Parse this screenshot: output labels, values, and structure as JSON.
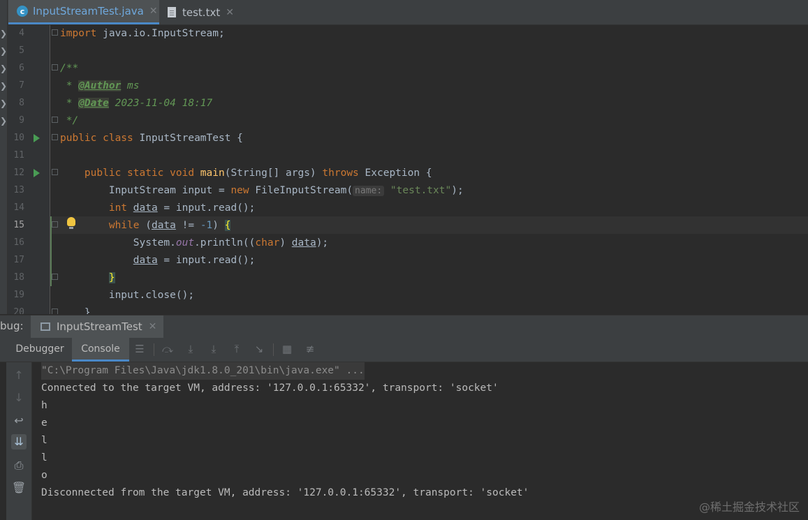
{
  "tabs": [
    {
      "label": "InputStreamTest.java",
      "icon": "java-class-icon",
      "active": true
    },
    {
      "label": "test.txt",
      "icon": "text-file-icon",
      "active": false
    }
  ],
  "tab_close": "✕",
  "editor": {
    "line_numbers": [
      "4",
      "5",
      "6",
      "7",
      "8",
      "9",
      "10",
      "11",
      "12",
      "13",
      "14",
      "15",
      "16",
      "17",
      "18",
      "19",
      "20"
    ],
    "current_line": "15",
    "code": {
      "l4_kw": "import",
      "l4_rest": " java.io.InputStream;",
      "l6": "/**",
      "l7_pre": " * ",
      "l7_tag": "@Author",
      "l7_val": " ms",
      "l8_pre": " * ",
      "l8_tag": "@Date",
      "l8_val": " 2023-11-04 18:17",
      "l9": " */",
      "l10_kw": "public class",
      "l10_rest": " InputStreamTest {",
      "l12_indent": "    ",
      "l12_kw": "public static void",
      "l12_sp": " ",
      "l12_fn": "main",
      "l12_args": "(String[] args) ",
      "l12_throws": "throws",
      "l12_rest": " Exception {",
      "l13_a": "        InputStream input = ",
      "l13_new": "new",
      "l13_b": " FileInputStream(",
      "l13_hint": "name:",
      "l13_sp": " ",
      "l13_str": "\"test.txt\"",
      "l13_c": ");",
      "l14_indent": "        ",
      "l14_kw": "int",
      "l14_sp": " ",
      "l14_var": "data",
      "l14_rest": " = input.read();",
      "l15_indent": "        ",
      "l15_kw": "while",
      "l15_a": " (",
      "l15_var": "data",
      "l15_b": " != ",
      "l15_num": "-1",
      "l15_c": ") ",
      "l15_brace": "{",
      "l16_a": "            System.",
      "l16_out": "out",
      "l16_b": ".println((",
      "l16_char": "char",
      "l16_c": ") ",
      "l16_var": "data",
      "l16_d": ");",
      "l17_indent": "            ",
      "l17_var": "data",
      "l17_rest": " = input.read();",
      "l18_indent": "        ",
      "l18_brace": "}",
      "l19": "        input.close();",
      "l20": "    }"
    }
  },
  "debug": {
    "title": "bug:",
    "session_tab": "InputStreamTest",
    "tabs": {
      "debugger": "Debugger",
      "console": "Console"
    },
    "toolbar_icons": [
      "menu-icon",
      "step-over-icon",
      "step-into-icon",
      "force-step-into-icon",
      "step-out-icon",
      "run-to-cursor-icon",
      "evaluate-icon",
      "trace-icon"
    ],
    "side_icons": [
      "up-arrow-icon",
      "down-arrow-icon",
      "soft-wrap-icon",
      "scroll-to-end-icon",
      "print-icon",
      "trash-icon"
    ]
  },
  "console": {
    "lines": [
      "\"C:\\Program Files\\Java\\jdk1.8.0_201\\bin\\java.exe\" ...",
      "Connected to the target VM, address: '127.0.0.1:65332', transport: 'socket'",
      "h",
      "e",
      "l",
      "l",
      "o",
      "Disconnected from the target VM, address: '127.0.0.1:65332', transport: 'socket'"
    ]
  },
  "watermark": "@稀土掘金技术社区",
  "colors": {
    "keyword": "#cc7832",
    "comment": "#629755",
    "string": "#6a8759",
    "number": "#6897bb",
    "accent": "#4a88c7"
  }
}
